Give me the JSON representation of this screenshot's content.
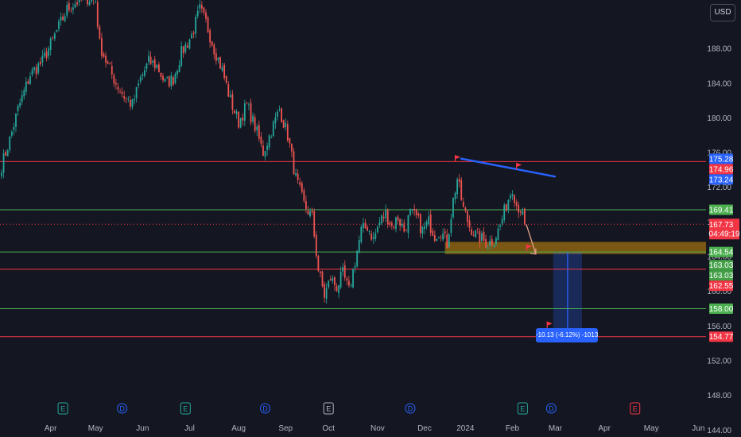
{
  "currency_label": "USD",
  "measure_label": "-10.13 (-6.12%) -1013",
  "countdown": "04:49:19",
  "chart_data": {
    "type": "candlestick",
    "title": "",
    "xlabel": "",
    "ylabel": "",
    "ylim": [
      143.2,
      193.6
    ],
    "grid": false,
    "price_ticks": [
      188.0,
      184.0,
      180.0,
      176.0,
      172.0,
      168.0,
      164.0,
      160.0,
      156.0,
      152.0,
      148.0,
      144.0
    ],
    "month_labels": [
      "Apr",
      "May",
      "Jun",
      "Jul",
      "Aug",
      "Sep",
      "Oct",
      "Nov",
      "Dec",
      "2024",
      "Feb",
      "Mar",
      "Apr",
      "May",
      "Jun"
    ],
    "month_index": [
      24,
      46,
      69,
      92,
      116,
      139,
      160,
      184,
      207,
      227,
      250,
      271,
      295,
      318,
      341
    ],
    "series_colors": {
      "up": "#26a69a",
      "down": "#ef5350"
    },
    "anchors": [
      {
        "i": 0,
        "p": 174.5
      },
      {
        "i": 4,
        "p": 177.5
      },
      {
        "i": 8,
        "p": 181.0
      },
      {
        "i": 14,
        "p": 185.0
      },
      {
        "i": 20,
        "p": 186.5
      },
      {
        "i": 26,
        "p": 189.5
      },
      {
        "i": 32,
        "p": 192.5
      },
      {
        "i": 40,
        "p": 194.0
      },
      {
        "i": 46,
        "p": 193.5
      },
      {
        "i": 48,
        "p": 188.5
      },
      {
        "i": 52,
        "p": 186.0
      },
      {
        "i": 56,
        "p": 184.0
      },
      {
        "i": 60,
        "p": 182.5
      },
      {
        "i": 64,
        "p": 181.5
      },
      {
        "i": 68,
        "p": 184.5
      },
      {
        "i": 72,
        "p": 186.5
      },
      {
        "i": 76,
        "p": 186.0
      },
      {
        "i": 80,
        "p": 184.0
      },
      {
        "i": 84,
        "p": 184.5
      },
      {
        "i": 88,
        "p": 187.5
      },
      {
        "i": 93,
        "p": 189.5
      },
      {
        "i": 97,
        "p": 192.5
      },
      {
        "i": 100,
        "p": 191.0
      },
      {
        "i": 104,
        "p": 188.0
      },
      {
        "i": 108,
        "p": 185.5
      },
      {
        "i": 112,
        "p": 182.0
      },
      {
        "i": 116,
        "p": 179.5
      },
      {
        "i": 120,
        "p": 181.5
      },
      {
        "i": 124,
        "p": 179.0
      },
      {
        "i": 128,
        "p": 176.0
      },
      {
        "i": 132,
        "p": 178.5
      },
      {
        "i": 136,
        "p": 181.0
      },
      {
        "i": 140,
        "p": 178.0
      },
      {
        "i": 144,
        "p": 173.0
      },
      {
        "i": 148,
        "p": 170.0
      },
      {
        "i": 152,
        "p": 168.5
      },
      {
        "i": 155,
        "p": 162.5
      },
      {
        "i": 158,
        "p": 159.5
      },
      {
        "i": 161,
        "p": 161.5
      },
      {
        "i": 164,
        "p": 160.5
      },
      {
        "i": 167,
        "p": 162.0
      },
      {
        "i": 170,
        "p": 160.0
      },
      {
        "i": 173,
        "p": 163.5
      },
      {
        "i": 176,
        "p": 167.0
      },
      {
        "i": 179,
        "p": 167.5
      },
      {
        "i": 182,
        "p": 166.0
      },
      {
        "i": 185,
        "p": 168.0
      },
      {
        "i": 188,
        "p": 169.0
      },
      {
        "i": 191,
        "p": 167.5
      },
      {
        "i": 194,
        "p": 168.5
      },
      {
        "i": 197,
        "p": 167.0
      },
      {
        "i": 200,
        "p": 169.0
      },
      {
        "i": 203,
        "p": 168.5
      },
      {
        "i": 206,
        "p": 167.0
      },
      {
        "i": 209,
        "p": 168.0
      },
      {
        "i": 212,
        "p": 166.5
      },
      {
        "i": 215,
        "p": 167.0
      },
      {
        "i": 218,
        "p": 165.5
      },
      {
        "i": 221,
        "p": 170.5
      },
      {
        "i": 223,
        "p": 173.0
      },
      {
        "i": 226,
        "p": 169.5
      },
      {
        "i": 229,
        "p": 167.5
      },
      {
        "i": 232,
        "p": 166.5
      },
      {
        "i": 235,
        "p": 166.0
      },
      {
        "i": 238,
        "p": 165.5
      },
      {
        "i": 241,
        "p": 166.0
      },
      {
        "i": 244,
        "p": 167.5
      },
      {
        "i": 247,
        "p": 170.0
      },
      {
        "i": 250,
        "p": 172.0
      },
      {
        "i": 252,
        "p": 170.0
      },
      {
        "i": 254,
        "p": 169.5
      },
      {
        "i": 256,
        "p": 167.73
      }
    ],
    "horizontal_levels": [
      {
        "value": 174.96,
        "color": "#f23645",
        "label": "174.96"
      },
      {
        "value": 169.41,
        "color": "#4caf50",
        "label": "169.41"
      },
      {
        "value": 164.54,
        "color": "#4caf50",
        "label": "164.54"
      },
      {
        "value": 162.55,
        "color": "#f23645",
        "label": "162.55"
      },
      {
        "value": 158.0,
        "color": "#4caf50",
        "label": "158.00"
      },
      {
        "value": 154.77,
        "color": "#f23645",
        "label": "154.77"
      }
    ],
    "price_tags": [
      {
        "value": 175.28,
        "color": "#2962ff",
        "label": "175.28"
      },
      {
        "value": 173.24,
        "color": "#2962ff",
        "label": "173.24"
      },
      {
        "value": 163.03,
        "color": "#43a047",
        "label": "163.03"
      },
      {
        "value": 163.03,
        "color": "#43a047",
        "label": "163.03"
      }
    ],
    "current_price": {
      "value": 167.73,
      "color": "#f23645",
      "label": "167.73"
    },
    "trendline": {
      "x1": 225,
      "y1": 175.3,
      "x2": 263,
      "y2": 173.24,
      "color": "#2962ff"
    },
    "zone": {
      "x1": 217,
      "x2": 350,
      "y_top": 165.7,
      "y_bottom": 164.3,
      "color": "#f7a600"
    },
    "measure_box": {
      "x1": 270,
      "x2": 284,
      "y_top": 164.54,
      "y_bottom": 154.41,
      "color": "#2962ff"
    },
    "events": [
      {
        "i": 30,
        "letter": "E",
        "color": "#26a69a"
      },
      {
        "i": 59,
        "letter": "D",
        "color": "#2962ff"
      },
      {
        "i": 90,
        "letter": "E",
        "color": "#26a69a"
      },
      {
        "i": 129,
        "letter": "D",
        "color": "#2962ff"
      },
      {
        "i": 160,
        "letter": "E",
        "color": "#b2b5be"
      },
      {
        "i": 200,
        "letter": "D",
        "color": "#2962ff"
      },
      {
        "i": 255,
        "letter": "E",
        "color": "#26a69a"
      },
      {
        "i": 269,
        "letter": "D",
        "color": "#2962ff"
      },
      {
        "i": 310,
        "letter": "E",
        "color": "#f23645"
      }
    ]
  }
}
